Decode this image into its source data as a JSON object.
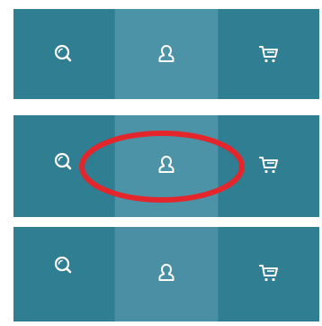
{
  "colors": {
    "tabbar_bg": "#2f7e92",
    "tab_active_bg": "#4d93a7",
    "icon_color": "#ffffff",
    "annotation_color": "#e3262c"
  },
  "frames": [
    {
      "tabs": [
        {
          "icon": "search-icon",
          "active": false
        },
        {
          "icon": "user-icon",
          "active": true
        },
        {
          "icon": "cart-icon",
          "active": false
        }
      ],
      "annotated": false
    },
    {
      "tabs": [
        {
          "icon": "search-icon",
          "active": false
        },
        {
          "icon": "user-icon",
          "active": true
        },
        {
          "icon": "cart-icon",
          "active": false
        }
      ],
      "annotated": true,
      "annotation": "red-ellipse-highlight"
    },
    {
      "tabs": [
        {
          "icon": "search-icon",
          "active": false
        },
        {
          "icon": "user-icon",
          "active": true
        },
        {
          "icon": "cart-icon",
          "active": false
        }
      ],
      "annotated": false
    }
  ]
}
